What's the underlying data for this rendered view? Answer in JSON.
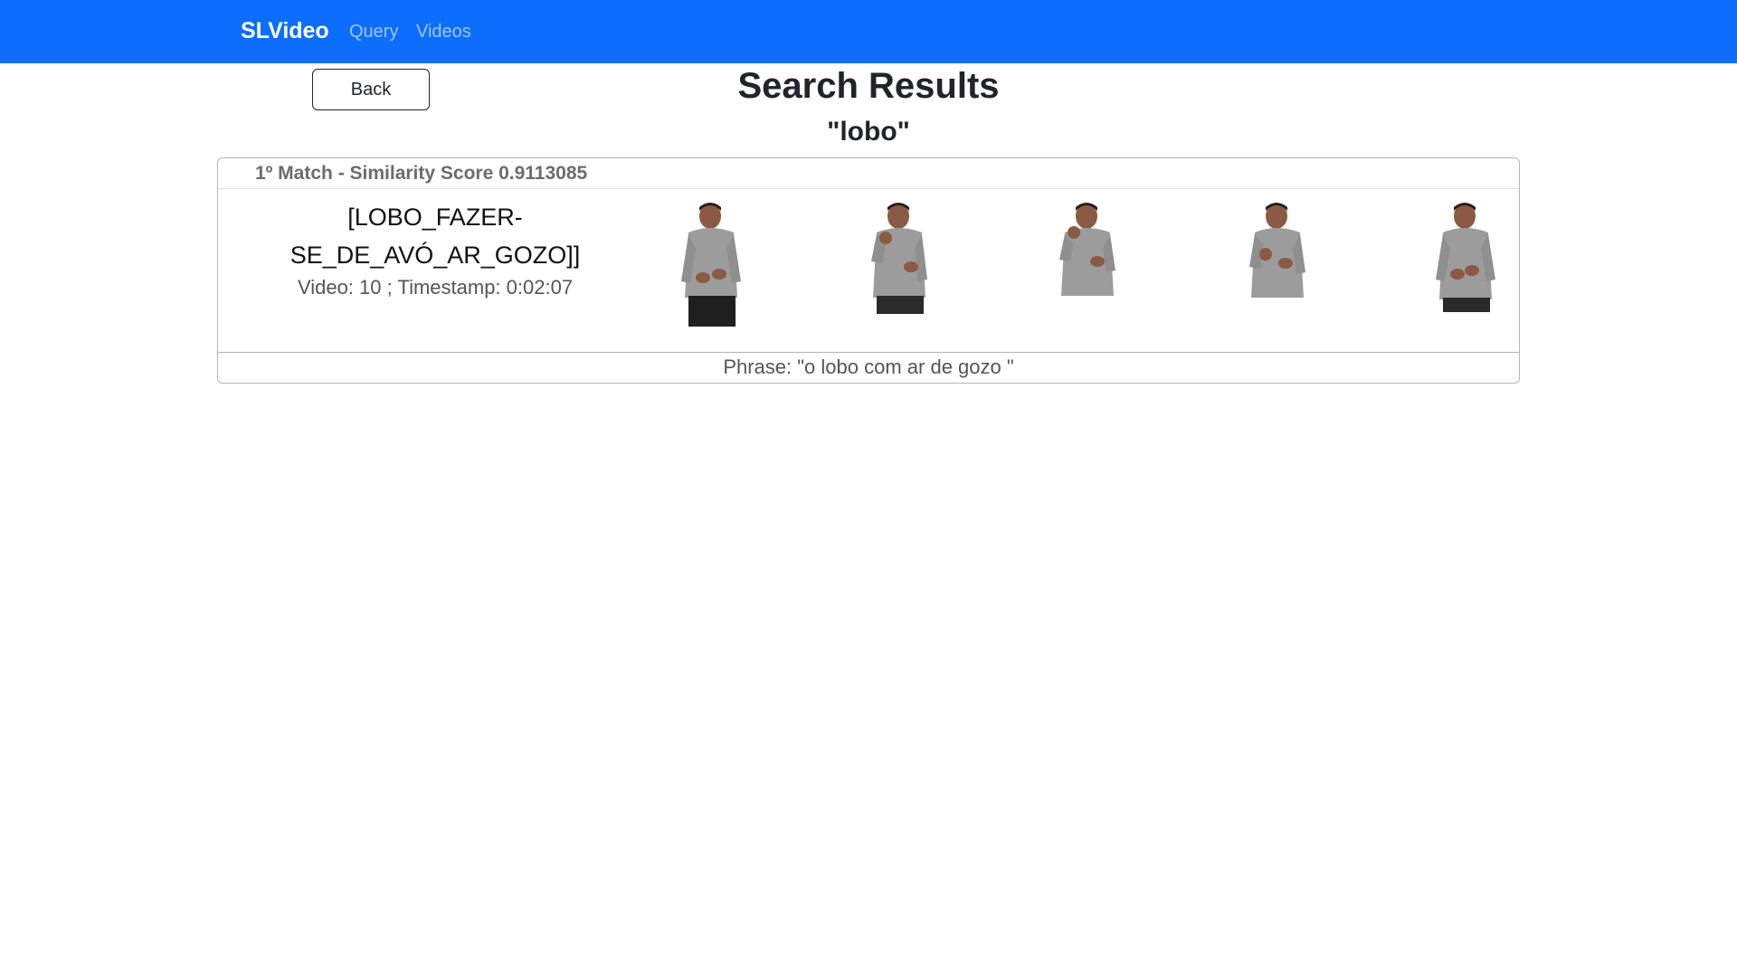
{
  "navbar": {
    "brand": "SLVideo",
    "links": [
      {
        "label": "Query"
      },
      {
        "label": "Videos"
      }
    ],
    "color": "#0d6efd"
  },
  "back_label": "Back",
  "page_title": "Search Results",
  "query": "\"lobo\"",
  "results": [
    {
      "match_title": "1º Match - Similarity Score 0.9113085",
      "gloss_line1": "[LOBO_FAZER-",
      "gloss_line2": "SE_DE_AVÓ_AR_GOZO]]",
      "meta": "Video: 10 ; Timestamp: 0:02:07",
      "phrase": "Phrase: \"o lobo com ar de gozo \"",
      "frames": [
        "frame-1",
        "frame-2",
        "frame-3",
        "frame-4",
        "frame-5"
      ]
    }
  ]
}
